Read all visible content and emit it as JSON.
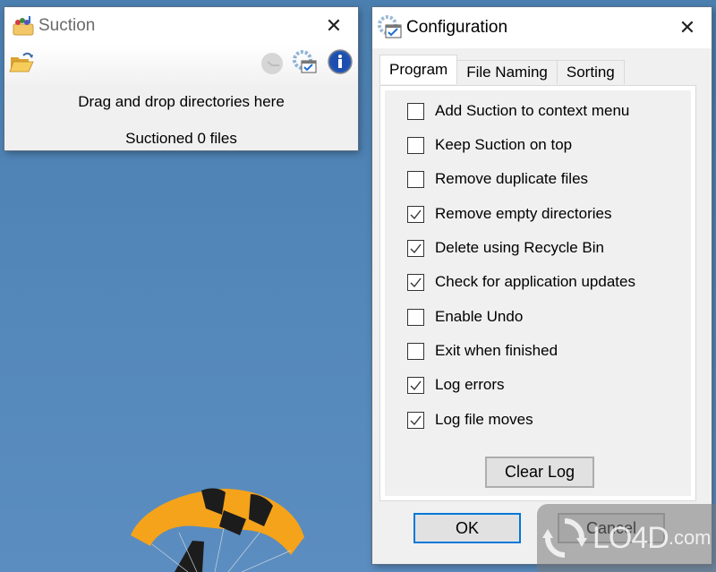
{
  "background": {
    "description": "blue sky wallpaper with a yellow and black parachute",
    "sky_color": "#5588bb",
    "canopy_colors": [
      "#f5a31a",
      "#1a1a1a"
    ]
  },
  "suction_window": {
    "title": "Suction",
    "app_icon": "basket-icon",
    "toolbar": {
      "open_folder_icon": "open-folder-icon",
      "undo_icon": "undo-history-icon",
      "config_icon": "settings-gear-icon",
      "about_icon": "info-icon"
    },
    "drop_hint": "Drag and drop directories here",
    "status": "Suctioned 0 files"
  },
  "config_window": {
    "title": "Configuration",
    "app_icon": "settings-gear-icon",
    "tabs": [
      {
        "label": "Program",
        "active": true
      },
      {
        "label": "File Naming",
        "active": false
      },
      {
        "label": "Sorting",
        "active": false
      }
    ],
    "options": [
      {
        "label": "Add Suction to context menu",
        "checked": false
      },
      {
        "label": "Keep Suction on top",
        "checked": false
      },
      {
        "label": "Remove duplicate files",
        "checked": false
      },
      {
        "label": "Remove empty directories",
        "checked": true
      },
      {
        "label": "Delete using Recycle Bin",
        "checked": true
      },
      {
        "label": "Check for application updates",
        "checked": true
      },
      {
        "label": "Enable Undo",
        "checked": false
      },
      {
        "label": "Exit when finished",
        "checked": false
      },
      {
        "label": "Log errors",
        "checked": true
      },
      {
        "label": "Log file moves",
        "checked": true
      }
    ],
    "clear_log_label": "Clear Log",
    "ok_label": "OK",
    "cancel_label": "Cancel",
    "accent_color": "#0078d7"
  },
  "watermark": {
    "text": "LO4D",
    "suffix": ".com"
  }
}
